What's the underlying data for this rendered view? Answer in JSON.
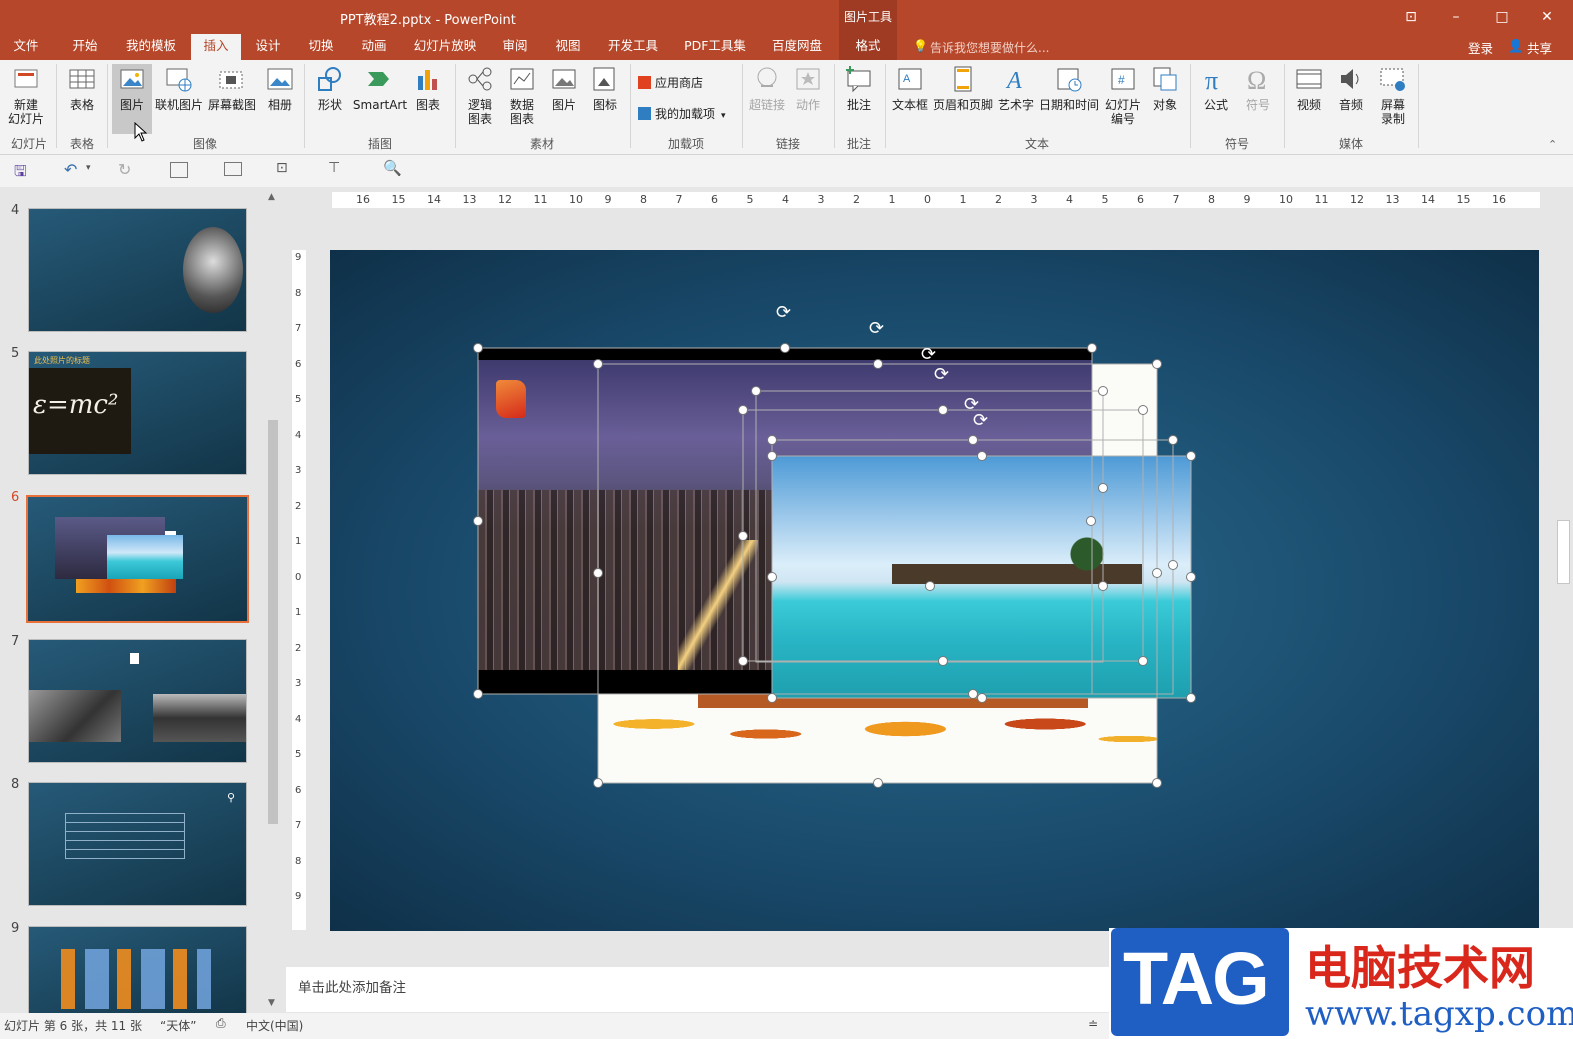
{
  "window": {
    "title": "PPT教程2.pptx - PowerPoint",
    "context_tool_label": "图片工具",
    "controls": [
      "⊡",
      "–",
      "□",
      "✕"
    ]
  },
  "tabs": [
    "文件",
    "开始",
    "我的模板",
    "插入",
    "设计",
    "切换",
    "动画",
    "幻灯片放映",
    "审阅",
    "视图",
    "开发工具",
    "PDF工具集",
    "百度网盘",
    "格式"
  ],
  "active_tab": "插入",
  "tell_me": "告诉我您想要做什么...",
  "account": {
    "login": "登录",
    "share": "共享"
  },
  "ribbon": {
    "new_slide": "新建\n幻灯片",
    "table": "表格",
    "picture": "图片",
    "online_picture": "联机图片",
    "screenshot": "屏幕截图",
    "album": "相册",
    "shapes": "形状",
    "smartart": "SmartArt",
    "chart": "图表",
    "logic_chart": "逻辑\n图表",
    "data_chart": "数据\n图表",
    "material_picture": "图片",
    "icon": "图标",
    "app_store": "应用商店",
    "my_addins": "我的加载项",
    "hyperlink": "超链接",
    "action": "动作",
    "comment": "批注",
    "textbox": "文本框",
    "header_footer": "页眉和页脚",
    "wordart": "艺术字",
    "datetime": "日期和时间",
    "slide_number": "幻灯片\n编号",
    "object": "对象",
    "equation": "公式",
    "symbol": "符号",
    "video": "视频",
    "audio": "音频",
    "screen_record": "屏幕\n录制",
    "groups": {
      "slides": "幻灯片",
      "tables": "表格",
      "images": "图像",
      "illustrations": "插图",
      "materials": "素材",
      "addins": "加载项",
      "links": "链接",
      "comments": "批注",
      "text": "文本",
      "symbols": "符号",
      "media": "媒体"
    }
  },
  "ruler_h": [
    "16",
    "15",
    "14",
    "13",
    "12",
    "11",
    "10",
    "9",
    "8",
    "7",
    "6",
    "5",
    "4",
    "3",
    "2",
    "1",
    "0",
    "1",
    "2",
    "3",
    "4",
    "5",
    "6",
    "7",
    "8",
    "9",
    "10",
    "11",
    "12",
    "13",
    "14",
    "15",
    "16"
  ],
  "ruler_v": [
    "9",
    "8",
    "7",
    "6",
    "5",
    "4",
    "3",
    "2",
    "1",
    "0",
    "1",
    "2",
    "3",
    "4",
    "5",
    "6",
    "7",
    "8",
    "9"
  ],
  "thumbnails": [
    {
      "num": "4",
      "caption": ""
    },
    {
      "num": "5",
      "caption": "此处照片的标题",
      "formula": "ε=mc²"
    },
    {
      "num": "6",
      "caption": ""
    },
    {
      "num": "7",
      "caption": ""
    },
    {
      "num": "8",
      "caption": ""
    },
    {
      "num": "9",
      "caption": ""
    }
  ],
  "selected_slide": "6",
  "notes_placeholder": "单击此处添加备注",
  "status": {
    "slide_info": "幻灯片 第 6 张，共 11 张",
    "theme": "“天体”",
    "language": "中文(中国)"
  },
  "watermark": {
    "tag": "TAG",
    "site_name": "电脑技术网",
    "url": "www.tagxp.com"
  },
  "colors": {
    "accent": "#b7472a",
    "ribbon_bg": "#f3f3f3",
    "selected_thumb_border": "#e8703a"
  }
}
